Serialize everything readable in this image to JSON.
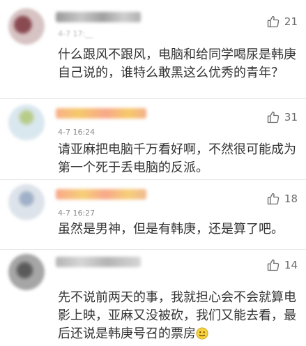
{
  "comments": [
    {
      "name": "",
      "time": "4-7 17:__",
      "likes": "21",
      "text": "什么跟风不跟风，电脑和给同学喝尿是韩庚自己说的，谁特么敢黑这么优秀的青年？",
      "avatar_colors": [
        "#d7c3c3",
        "#8a4a52",
        "#ffffff"
      ],
      "name_colors": [
        "#9a9a9a",
        "#c8c8c8"
      ]
    },
    {
      "name": "",
      "time": "4-7 16:24",
      "likes": "31",
      "text": "请亚麻把电脑千万看好啊，不然很可能成为第一个死于丢电脑的反派。",
      "avatar_colors": [
        "#d9e7ef",
        "#b8cc8a",
        "#ffffff"
      ],
      "name_colors": [
        "#f8b18a",
        "#f6c96a"
      ]
    },
    {
      "name": "",
      "time": "4-7 16:27",
      "likes": "18",
      "text": "虽然是男神，但是有韩庚，还是算了吧。",
      "avatar_colors": [
        "#dde3ea",
        "#9fb0c8",
        "#ffffff"
      ],
      "name_colors": [
        "#f8a88a",
        "#f6cf78"
      ]
    },
    {
      "name": "",
      "time": "",
      "likes": "14",
      "text": "先不说前两天的事，我就担心会不会就算电影上映，亚麻又没被砍，我们又能去看，最后还说是韩庚号召的票房",
      "avatar_colors": [
        "#a6a6a6",
        "#5a5a5a",
        "#e2e2e2"
      ],
      "name_colors": [
        "#b5b5b5",
        "#d6d6d6"
      ]
    }
  ],
  "colors": {
    "text": "#333333",
    "time": "#8a8a8a",
    "like": "#6b6b6b",
    "divider": "#e6e6e6"
  },
  "icons": {
    "like": "thumbs-up-icon",
    "emoji": "smiley-emoji-icon"
  }
}
